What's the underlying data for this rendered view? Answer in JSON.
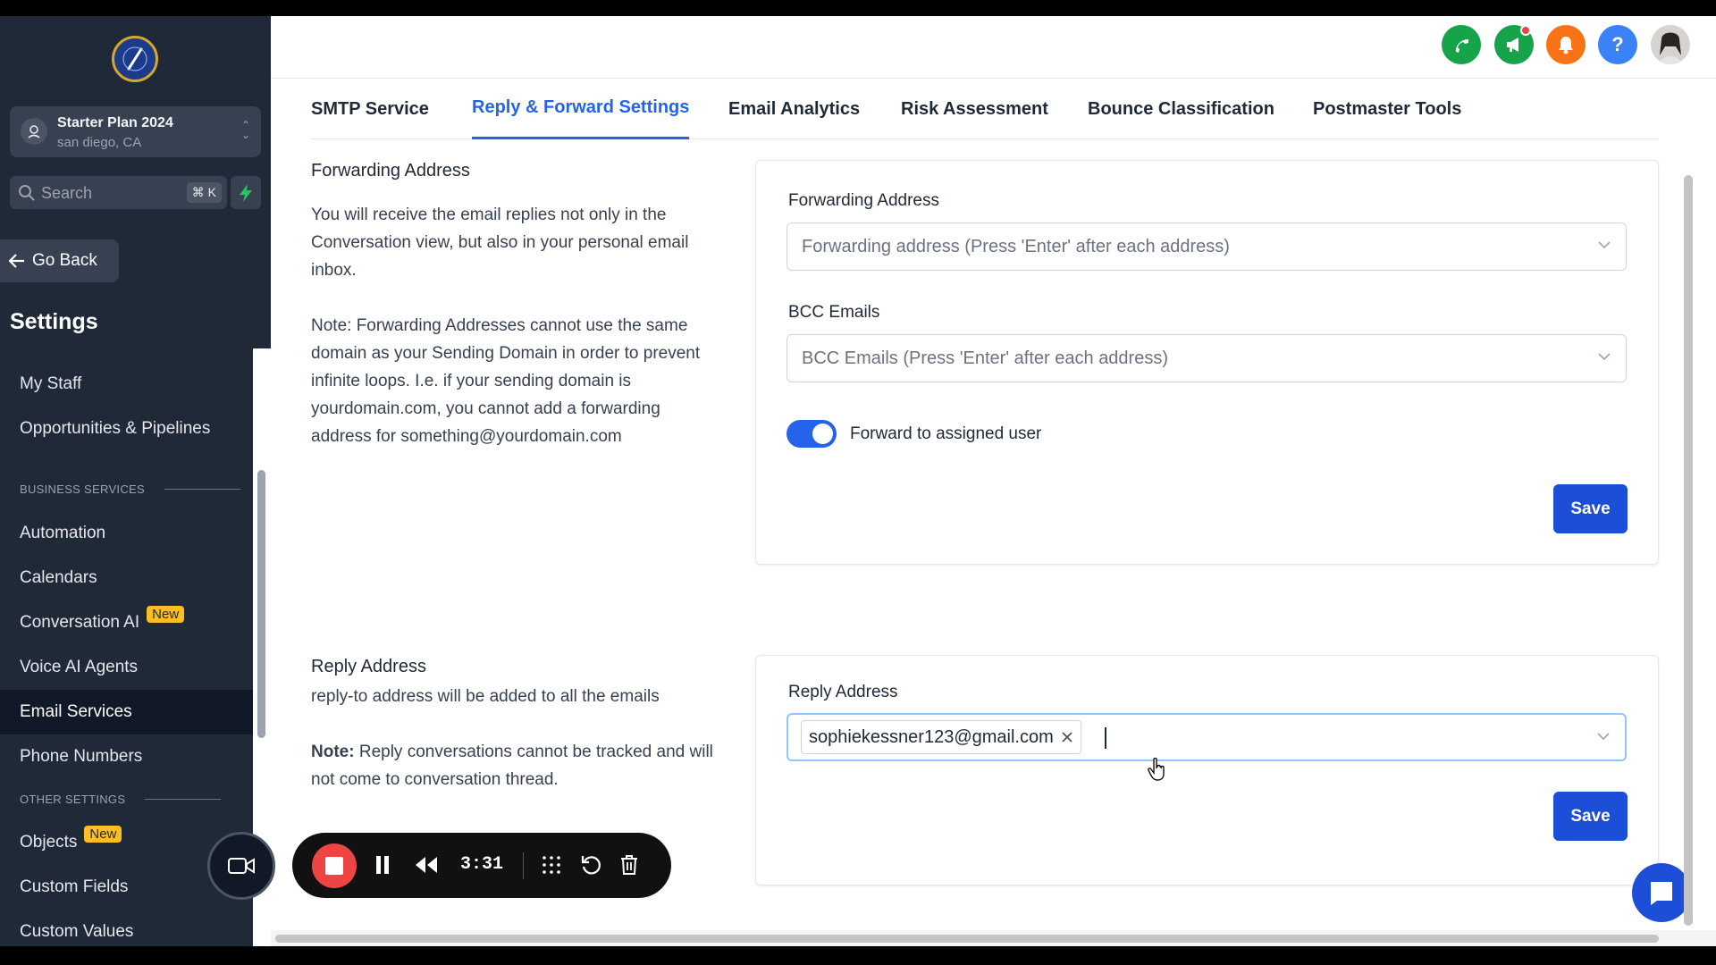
{
  "account": {
    "name": "Starter Plan 2024",
    "location": "san diego, CA"
  },
  "search": {
    "placeholder": "Search",
    "shortcut": "⌘ K"
  },
  "sidebar": {
    "go_back": "Go Back",
    "title": "Settings",
    "items": {
      "my_staff": "My Staff",
      "opportunities": "Opportunities & Pipelines",
      "section_business": "BUSINESS SERVICES",
      "automation": "Automation",
      "calendars": "Calendars",
      "conversation_ai": "Conversation AI",
      "voice_ai": "Voice AI Agents",
      "email_services": "Email Services",
      "phone_numbers": "Phone Numbers",
      "section_other": "OTHER SETTINGS",
      "objects": "Objects",
      "custom_fields": "Custom Fields",
      "custom_values": "Custom Values"
    },
    "badge_new": "New",
    "active_item": "Email Services"
  },
  "tabs": [
    "SMTP Service",
    "Reply & Forward Settings",
    "Email Analytics",
    "Risk Assessment",
    "Bounce Classification",
    "Postmaster Tools"
  ],
  "active_tab": "Reply & Forward Settings",
  "forwarding": {
    "title": "Forwarding Address",
    "desc": "You will receive the email replies not only in the Conversation view, but also in your personal email inbox.",
    "note": "Note: Forwarding Addresses cannot use the same domain as your Sending Domain in order to prevent infinite loops. I.e. if your sending domain is yourdomain.com, you cannot add a forwarding address for something@yourdomain.com",
    "field_label": "Forwarding Address",
    "field_placeholder": "Forwarding address (Press 'Enter' after each address)",
    "bcc_label": "BCC Emails",
    "bcc_placeholder": "BCC Emails (Press 'Enter' after each address)",
    "toggle_label": "Forward to assigned user",
    "toggle_on": true,
    "save": "Save"
  },
  "reply": {
    "title": "Reply Address",
    "desc": "reply-to address will be added to all the emails",
    "note_bold": "Note:",
    "note": " Reply conversations cannot be tracked and will not come to conversation thread.",
    "field_label": "Reply Address",
    "chip_value": "sophiekessner123@gmail.com",
    "save": "Save"
  },
  "recorder": {
    "time": "3:31"
  },
  "colors": {
    "accent": "#2563eb",
    "sidebar_bg": "#1f2937",
    "phone_green": "#16a34a",
    "bell_orange": "#f97316",
    "record_red": "#ef4444"
  }
}
